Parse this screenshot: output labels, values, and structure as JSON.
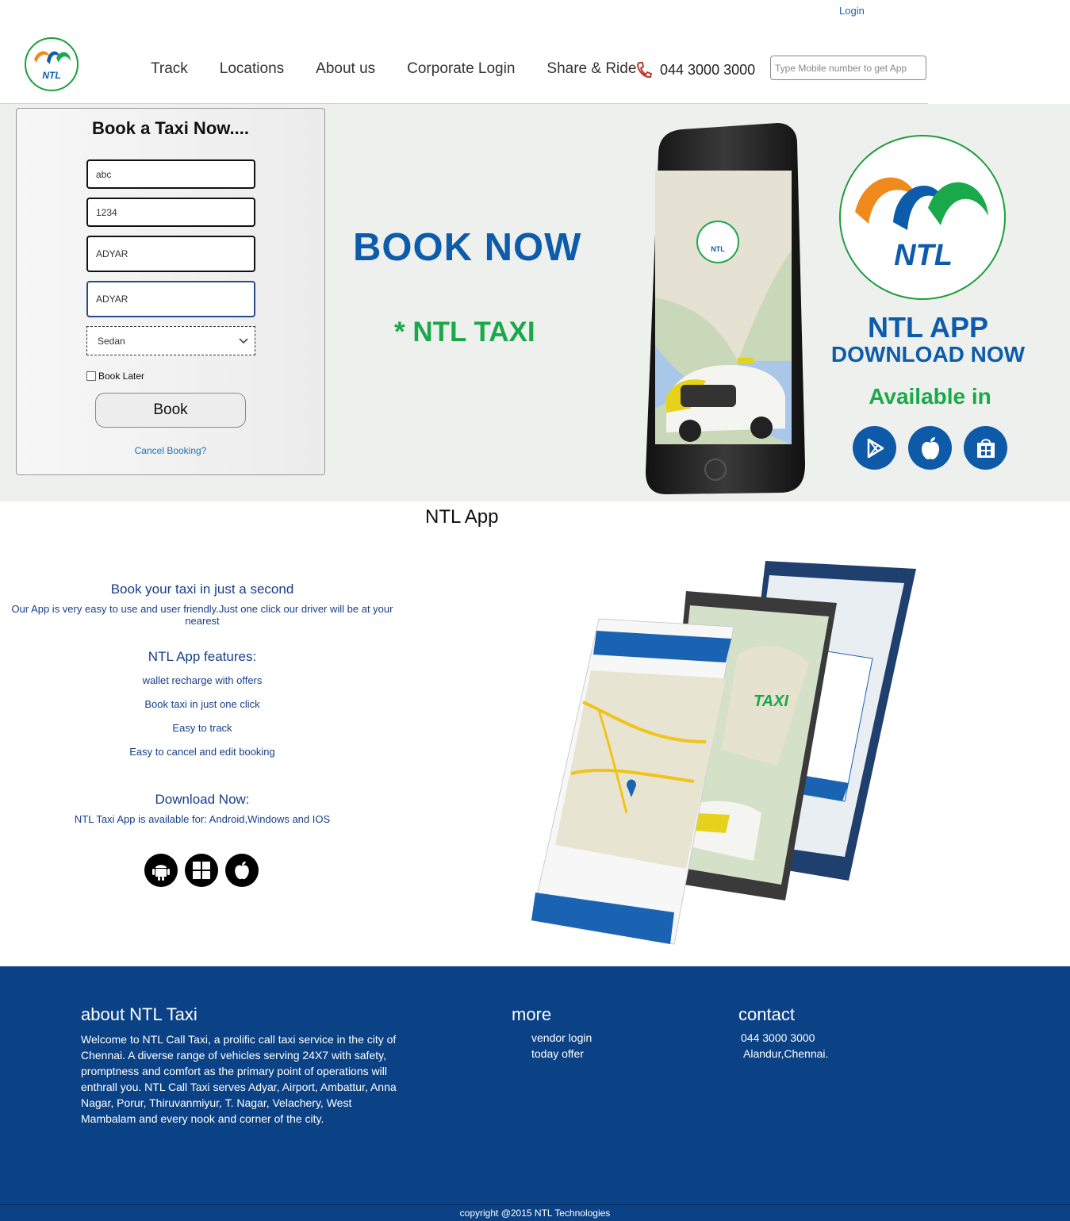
{
  "header": {
    "login_label": "Login",
    "nav": [
      "Track",
      "Locations",
      "About us",
      "Corporate Login",
      "Share & Ride"
    ],
    "phone": "044 3000 3000",
    "app_input_placeholder": "Type Mobile number to get App",
    "logo_text": "NTL"
  },
  "booking": {
    "title": "Book a Taxi Now....",
    "name_value": "abc",
    "mobile_value": "1234",
    "pickup_value": "ADYAR",
    "drop_value": "ADYAR",
    "vehicle_selected": "Sedan",
    "book_later_label": "Book Later",
    "book_label": "Book",
    "cancel_label": "Cancel Booking?"
  },
  "hero": {
    "book_now": "BOOK NOW",
    "ntl_taxi": "* NTL TAXI",
    "app_title": "NTL APP",
    "download_now": "DOWNLOAD NOW",
    "available_in": "Available in",
    "stores": [
      "google-play-icon",
      "apple-icon",
      "windows-store-icon"
    ]
  },
  "app_section": {
    "title": "NTL App",
    "tagline": "Book your taxi in just a second",
    "tagline_desc": "Our App is very easy to use and user friendly.Just one click our driver will be at your nearest",
    "features_title": "NTL App features:",
    "features": [
      "wallet recharge with offers",
      "Book taxi in just one click",
      "Easy to track",
      "Easy to cancel and edit booking"
    ],
    "download_title": "Download Now:",
    "download_desc": "NTL Taxi App is available for: Android,Windows and IOS",
    "os": [
      "android-icon",
      "windows-icon",
      "apple-icon"
    ]
  },
  "footer": {
    "about_title": "about NTL Taxi",
    "about_text": "Welcome to NTL Call Taxi, a prolific call taxi service in the city of Chennai. A diverse range of vehicles serving 24X7 with safety, promptness and comfort as the primary point of operations will enthrall you. NTL Call Taxi serves Adyar, Airport, Ambattur, Anna Nagar, Porur, Thiruvanmiyur, T. Nagar, Velachery, West Mambalam and every nook and corner of the city.",
    "more_title": "more",
    "more_links": [
      "vendor login",
      "today offer"
    ],
    "contact_title": "contact",
    "contact_phone": "044 3000 3000",
    "contact_address": "Alandur,Chennai.",
    "copyright": "copyright @2015 NTL Technologies"
  },
  "colors": {
    "brand_blue": "#0d5cab",
    "brand_green": "#1aa94a",
    "brand_orange": "#f08a1c",
    "footer_bg": "#0b4286"
  }
}
